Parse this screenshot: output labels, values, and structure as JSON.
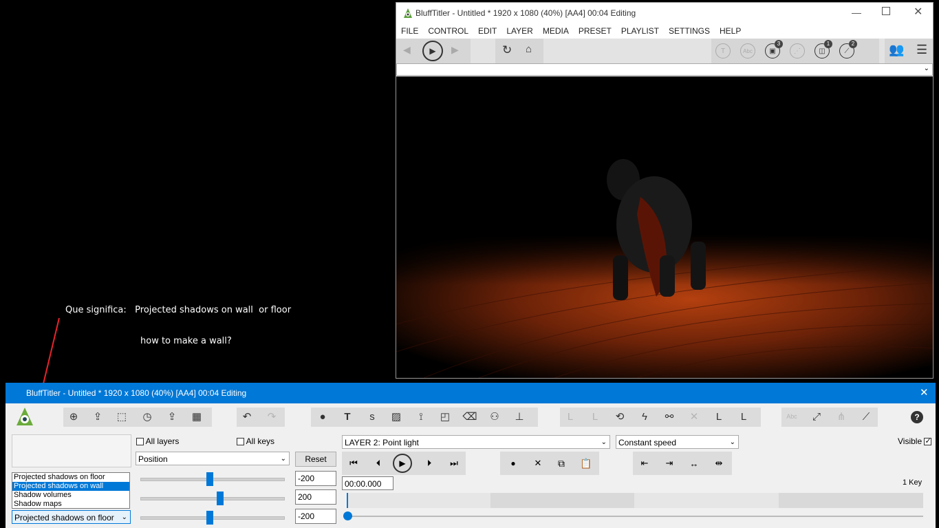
{
  "annotation": {
    "line1": "Que significa:   Projected shadows on wall  or floor",
    "line2": "how to make a wall?",
    "arrow_color": "#e8242b"
  },
  "preview": {
    "title": "BluffTitler - Untitled * 1920 x 1080 (40%) [AA4] 00:04 Editing",
    "menu": [
      "FILE",
      "CONTROL",
      "EDIT",
      "LAYER",
      "MEDIA",
      "PRESET",
      "PLAYLIST",
      "SETTINGS",
      "HELP"
    ],
    "badges": {
      "media": "3",
      "model": "1",
      "effect": "2"
    },
    "playlist_value": ""
  },
  "editor": {
    "title": "BluffTitler - Untitled * 1920 x 1080 (40%) [AA4] 00:04 Editing",
    "all_layers_label": "All layers",
    "all_keys_label": "All keys",
    "property_value": "Position",
    "reset_label": "Reset",
    "layer_value": "LAYER 2: Point light",
    "speed_value": "Constant speed",
    "visible_label": "Visible",
    "values": [
      "-200",
      "200",
      "-200"
    ],
    "sliders": [
      0.48,
      0.55,
      0.48
    ],
    "time_value": "00:00.000",
    "key_count": "1 Key",
    "shadow_options": [
      "Projected shadows on floor",
      "Projected shadows on wall",
      "Shadow volumes",
      "Shadow maps"
    ],
    "shadow_selected": "Projected shadows on floor",
    "accent": "#0078d7"
  }
}
